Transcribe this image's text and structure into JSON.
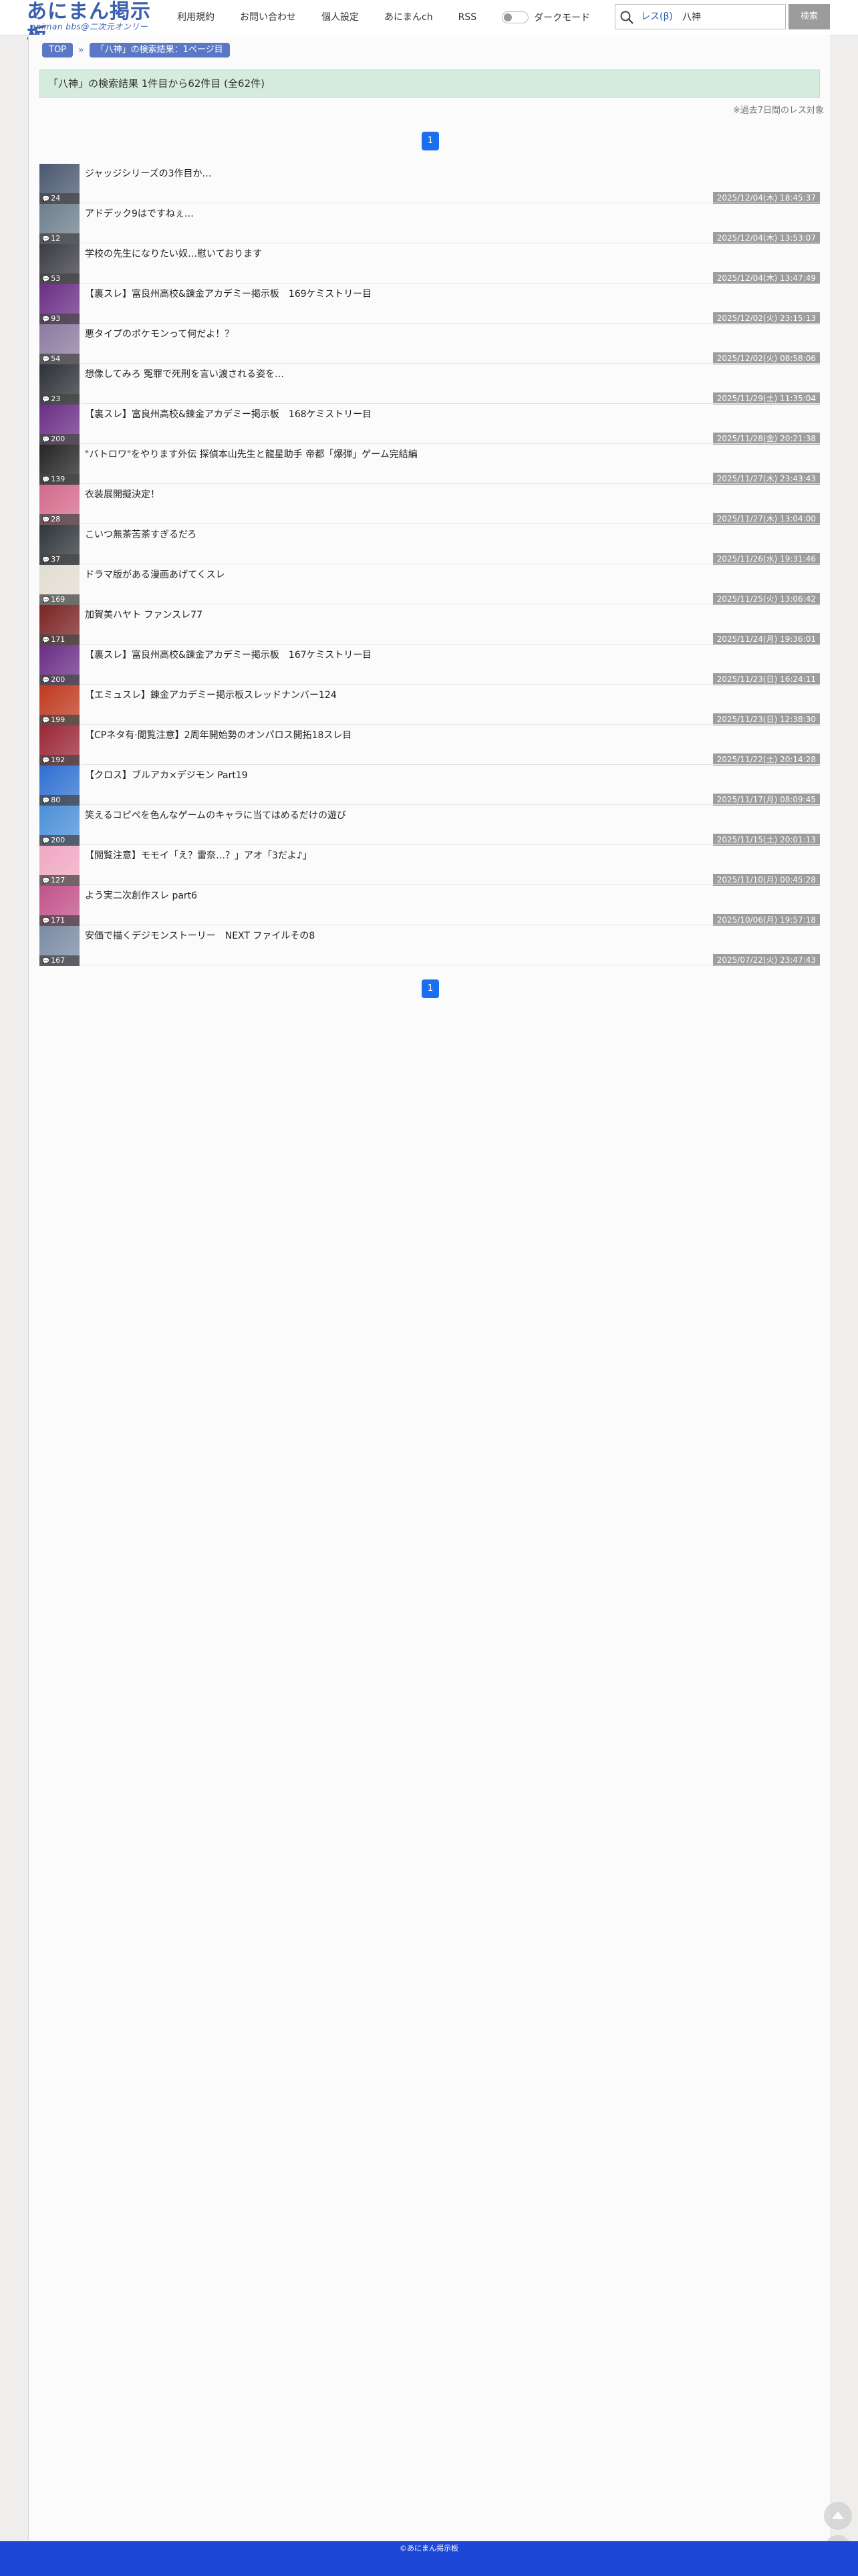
{
  "header": {
    "logo_main": "あにまん掲示板",
    "logo_sub": "animan bbs@二次元オンリー",
    "nav": [
      "利用規約",
      "お問い合わせ",
      "個人設定",
      "あにまんch",
      "RSS"
    ],
    "dark_mode_label": "ダークモード",
    "search_scope": "レス(β)",
    "search_value": "八神",
    "search_button": "検索"
  },
  "breadcrumb": {
    "top": "TOP",
    "current": "「八神」の検索結果：1ページ目"
  },
  "result_summary": "「八神」の検索結果 1件目から62件目 (全62件)",
  "note": "※過去7日間のレス対象",
  "pagination": {
    "current": "1"
  },
  "threads": [
    {
      "title": "ジャッジシリーズの3作目か…",
      "count": "24",
      "date": "2025/12/04(木) 18:45:37",
      "color": "#4a5870"
    },
    {
      "title": "アドデック9はですねぇ…",
      "count": "12",
      "date": "2025/12/04(木) 13:53:07",
      "color": "#6e7f8d"
    },
    {
      "title": "学校の先生になりたい奴…慰いております",
      "count": "53",
      "date": "2025/12/04(木) 13:47:49",
      "color": "#3c3c44"
    },
    {
      "title": "【裏スレ】富良州高校&錬金アカデミー掲示板　169ケミストリー目",
      "count": "93",
      "date": "2025/12/02(火) 23:15:13",
      "color": "#6b2e86"
    },
    {
      "title": "悪タイプのポケモンって何だよ！？",
      "count": "54",
      "date": "2025/12/02(火) 08:58:06",
      "color": "#8d7ba0"
    },
    {
      "title": "想像してみろ 冤罪で死刑を言い渡される姿を…",
      "count": "23",
      "date": "2025/11/29(土) 11:35:04",
      "color": "#2e3138"
    },
    {
      "title": "【裏スレ】富良州高校&錬金アカデミー掲示板　168ケミストリー目",
      "count": "200",
      "date": "2025/11/28(金) 20:21:38",
      "color": "#6b2e86"
    },
    {
      "title": "\"バトロワ\"をやります外伝 探偵本山先生と龍星助手 帝都「爆弾」ゲーム完結編",
      "count": "139",
      "date": "2025/11/27(木) 23:43:43",
      "color": "#252525"
    },
    {
      "title": "衣装展開擬決定！",
      "count": "28",
      "date": "2025/11/27(木) 13:04:00",
      "color": "#d46a8c"
    },
    {
      "title": "こいつ無茶苦茶すぎるだろ",
      "count": "37",
      "date": "2025/11/26(水) 19:31:46",
      "color": "#30363c"
    },
    {
      "title": "ドラマ版がある漫画あげてくスレ",
      "count": "169",
      "date": "2025/11/25(火) 13:06:42",
      "color": "#e2ddd2"
    },
    {
      "title": "加賀美ハヤト ファンスレ77",
      "count": "171",
      "date": "2025/11/24(月) 19:36:01",
      "color": "#7a2424"
    },
    {
      "title": "【裏スレ】富良州高校&錬金アカデミー掲示板　167ケミストリー目",
      "count": "200",
      "date": "2025/11/23(日) 16:24:11",
      "color": "#6b2e86"
    },
    {
      "title": "【エミュスレ】錬金アカデミー掲示板スレッドナンバー124",
      "count": "199",
      "date": "2025/11/23(日) 12:38:30",
      "color": "#c0391e"
    },
    {
      "title": "【CPネタ有·閲覧注意】2周年開始勢のオンパロス開拓18スレ目",
      "count": "192",
      "date": "2025/11/22(土) 20:14:28",
      "color": "#9a2636"
    },
    {
      "title": "【クロス】ブルアカ×デジモン Part19",
      "count": "80",
      "date": "2025/11/17(月) 08:09:45",
      "color": "#2f6fd1"
    },
    {
      "title": "笑えるコピペを色んなゲームのキャラに当てはめるだけの遊び",
      "count": "200",
      "date": "2025/11/15(土) 20:01:13",
      "color": "#4b8fd8"
    },
    {
      "title": "【閲覧注意】モモイ「え？雷奈…？」アオ「3だよ♪」",
      "count": "127",
      "date": "2025/11/10(月) 00:45:28",
      "color": "#f0a8c2"
    },
    {
      "title": "よう実二次創作スレ part6",
      "count": "171",
      "date": "2025/10/06(月) 19:57:18",
      "color": "#c2528a"
    },
    {
      "title": "安価で描くデジモンストーリー　NEXT ファイルその8",
      "count": "167",
      "date": "2025/07/22(火) 23:47:43",
      "color": "#7a8ba3"
    }
  ],
  "footer_text": "©あにまん掲示板"
}
